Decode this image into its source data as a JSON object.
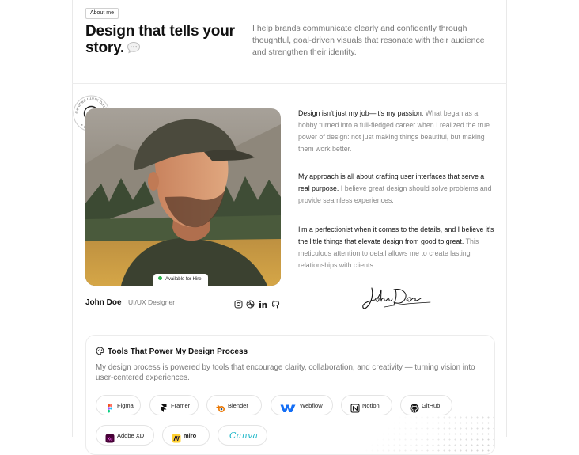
{
  "header": {
    "badge": "About me",
    "title": "Design that tells your story.",
    "title_icon": "chat-bubble-icon",
    "description": "I help brands communicate clearly and confidently through thoughtful, goal-driven visuals that resonate with their audience and strengthen their identity."
  },
  "certificate": {
    "ring_text": "Certified UI/UX Designer • Since 2018 • ",
    "icon": "shapes-icon"
  },
  "profile": {
    "availability": "Available for Hire",
    "availability_color": "#2bb24c",
    "name": "John Doe",
    "role": "UI/UX Designer",
    "socials": [
      "instagram-icon",
      "dribbble-icon",
      "linkedin-icon",
      "github-icon"
    ]
  },
  "bio": {
    "p1_strong": "Design isn't just my job—it's my passion.",
    "p1_rest": " What began as a hobby turned into a full-fledged career when I realized the true power of design: not just making things beautiful, but making them work better.",
    "p2_strong": "My approach is all about crafting user interfaces that serve a real purpose.",
    "p2_rest": " I believe great design should solve problems and provide seamless experiences.",
    "p3_strong": "I'm a perfectionist when it comes to the details, and I believe it's the little things that elevate design from good to great.",
    "p3_rest": " This meticulous attention to detail allows me to create lasting relationships with clients ."
  },
  "signature": {
    "text": "John Doe"
  },
  "tools": {
    "title": "Tools That Power My Design Process",
    "description": "My design process is powered by tools that encourage clarity, collaboration, and creativity — turning vision into user-centered experiences.",
    "items": [
      {
        "label": "Figma",
        "icon": "figma-icon"
      },
      {
        "label": "Framer",
        "icon": "framer-icon"
      },
      {
        "label": "Blender",
        "icon": "blender-icon"
      },
      {
        "label": "Webflow",
        "icon": "webflow-icon"
      },
      {
        "label": "Notion",
        "icon": "notion-icon"
      },
      {
        "label": "GitHub",
        "icon": "github-icon"
      },
      {
        "label": "Adobe XD",
        "icon": "adobe-xd-icon"
      },
      {
        "label": "miro",
        "icon": "miro-icon"
      },
      {
        "label": "Canva",
        "icon": "canva-icon"
      }
    ]
  },
  "colors": {
    "accent_green": "#2bb24c",
    "text_dark": "#111111",
    "text_muted": "#777777",
    "border": "#e4e4e4"
  }
}
